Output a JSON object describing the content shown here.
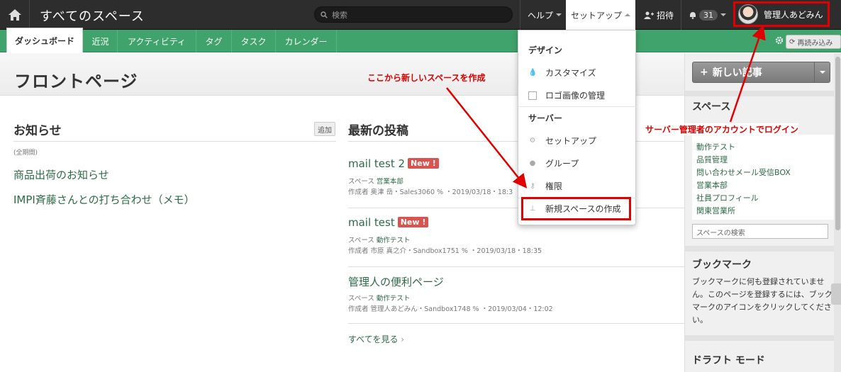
{
  "topbar": {
    "title": "すべてのスペース",
    "search_placeholder": "検索",
    "help": "ヘルプ",
    "setup": "セットアップ",
    "invite": "招待",
    "notifications": "31",
    "user": "管理人あどみん"
  },
  "tabs": [
    "ダッシュボード",
    "近況",
    "アクティビティ",
    "タグ",
    "タスク",
    "カレンダー"
  ],
  "toolbar": {
    "reload": "再読み込み"
  },
  "page_title": "フロントページ",
  "notices": {
    "title": "お知らせ",
    "add": "追加",
    "period": "(全期間)",
    "items": [
      "商品出荷のお知らせ",
      "IMPI斉藤さんとの打ち合わせ（メモ）"
    ]
  },
  "posts": {
    "title": "最新の投稿",
    "new_label": "New !",
    "see_all": "すべてを見る",
    "items": [
      {
        "title": "mail test 2",
        "is_new": true,
        "space_label": "スペース",
        "space": "営業本部",
        "author_label": "作成者",
        "author": "奥津 岳",
        "meta": "・Sales3060 % ・2019/03/18・18:3"
      },
      {
        "title": "mail test",
        "is_new": true,
        "space_label": "スペース",
        "space": "動作テスト",
        "author_label": "作成者",
        "author": "市原 真之介",
        "meta": "・Sandbox1751 % ・2019/03/18・18:35"
      },
      {
        "title": "管理人の便利ページ",
        "is_new": false,
        "space_label": "スペース",
        "space": "動作テスト",
        "author_label": "作成者",
        "author": "管理人あどみん",
        "meta": "・Sandbox1748 % ・2019/03/04・12:02"
      }
    ]
  },
  "setup_menu": {
    "design": "デザイン",
    "customize": "カスタマイズ",
    "logo": "ロゴ画像の管理",
    "server": "サーバー",
    "setup": "セットアップ",
    "groups": "グループ",
    "permissions": "権限",
    "new_space": "新規スペースの作成"
  },
  "sidebar": {
    "new_post": "新しい記事",
    "spaces_title": "スペース",
    "spaces": [
      "動作テスト",
      "品質管理",
      "問い合わせメール受信BOX",
      "営業本部",
      "社員プロフィール",
      "関東営業所"
    ],
    "space_search": "スペースの検索",
    "bookmark_title": "ブックマーク",
    "bookmark_text": "ブックマークに何も登録されていません。このページを登録するには、ブックマークのアイコンをクリックしてください。",
    "draft_title": "ドラフト モード"
  },
  "annotations": {
    "create_space": "ここから新しいスペースを作成",
    "login": "サーバー管理者のアカウントでログイン"
  },
  "colors": {
    "topbar": "#2d2d2d",
    "tabbar": "#3fa36b",
    "link": "#2c6a47",
    "annotation": "#e00000",
    "new_badge": "#d9534f"
  }
}
